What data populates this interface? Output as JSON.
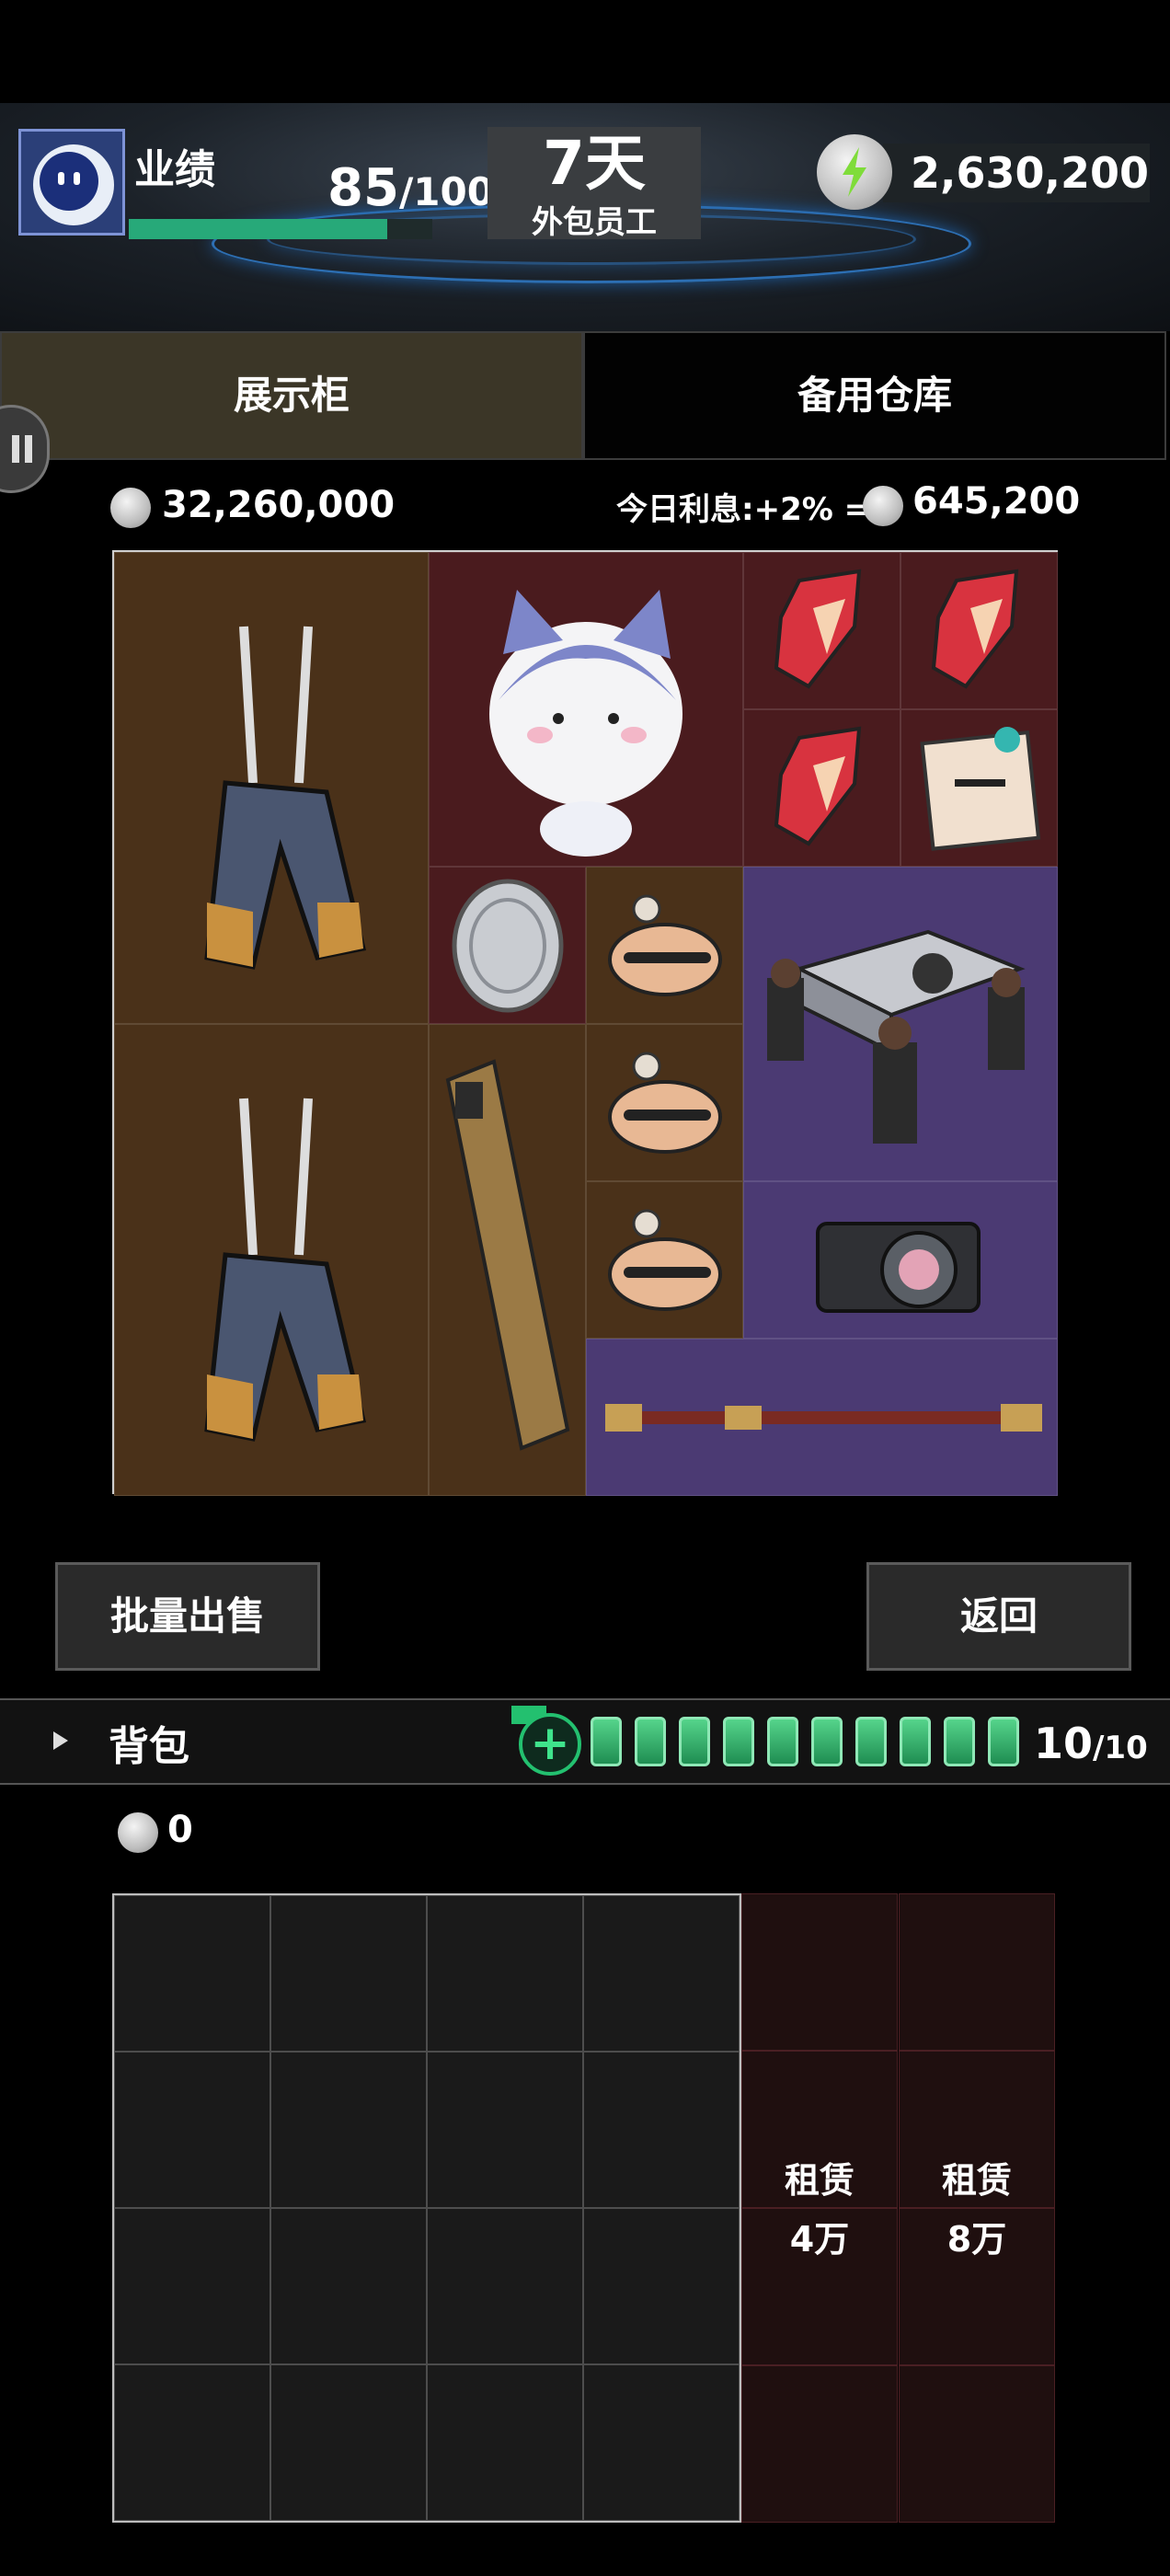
{
  "header": {
    "performance_label": "业绩",
    "performance_value": "85",
    "performance_max": "/100",
    "performance_progress": 0.85,
    "days_big": "7天",
    "days_sub": "外包员工",
    "currency": "2,630,200"
  },
  "tabs": [
    {
      "label": "展示柜",
      "active": true
    },
    {
      "label": "备用仓库",
      "active": false
    }
  ],
  "vault": {
    "amount": "32,260,000",
    "interest_label": "今日利息:+2% =",
    "interest_value": "645,200"
  },
  "display_items": [
    "overalls-icon",
    "cat-mascot-icon",
    "red-crystal-icon",
    "red-crystal-icon",
    "red-crystal-icon",
    "congratulations-card-icon",
    "silver-coin-icon",
    "bun-with-clip-icon",
    "coffin-dance-speaker-icon",
    "bun-with-clip-icon",
    "overalls-icon",
    "gold-phone-icon",
    "bun-with-clip-icon",
    "camera-icon",
    "ornate-staff-icon"
  ],
  "buttons": {
    "bulk_sell": "批量出售",
    "back": "返回"
  },
  "backpack": {
    "title": "背包",
    "count": "10",
    "count_max": "/10",
    "amount": "0",
    "rent": [
      {
        "label": "租赁",
        "price": "4万"
      },
      {
        "label": "租赁",
        "price": "8万"
      }
    ]
  }
}
